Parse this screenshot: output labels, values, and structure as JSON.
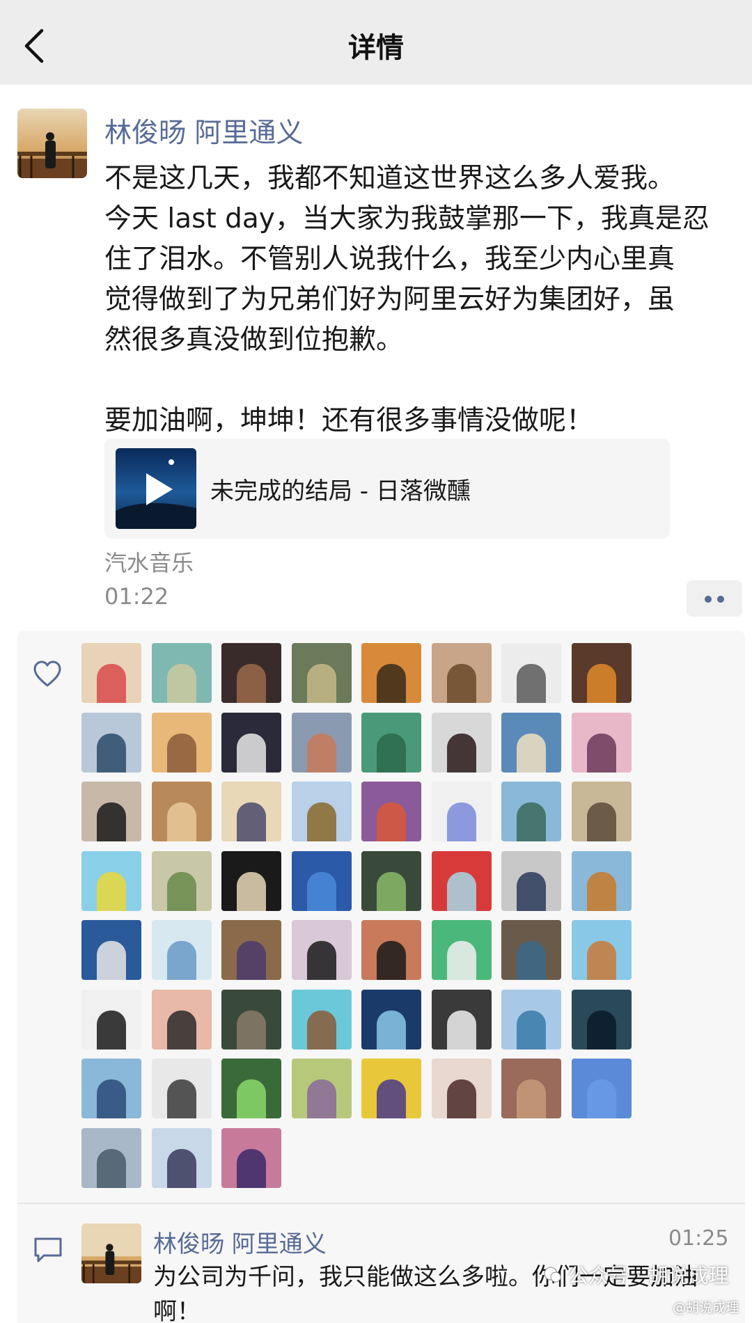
{
  "navbar": {
    "title": "详情",
    "back_icon": "chevron-left-icon"
  },
  "post": {
    "author": "林俊旸 阿里通义",
    "text": "不是这几天，我都不知道这世界这么多人爱我。\n今天 last day，当大家为我鼓掌那一下，我真是忍\n住了泪水。不管别人说我什么，我至少内心里真\n觉得做到了为兄弟们好为阿里云好为集团好，虽\n然很多真没做到位抱歉。\n\n要加油啊，坤坤！还有很多事情没做呢！",
    "music": {
      "title": "未完成的结局 - 日落微醺",
      "play_icon": "play-icon"
    },
    "source": "汽水音乐",
    "time": "01:22",
    "more_icon": "more-dots-icon"
  },
  "likes": {
    "heart_icon": "heart-icon",
    "avatars": [
      {
        "bg": "#e8d3b8",
        "fg": "#d84a4a"
      },
      {
        "bg": "#7fb8b0",
        "fg": "#c9c9a0"
      },
      {
        "bg": "#3a2b2b",
        "fg": "#9a6a4a"
      },
      {
        "bg": "#6a7a5a",
        "fg": "#c4b88a"
      },
      {
        "bg": "#d88a3a",
        "fg": "#3a2a1a"
      },
      {
        "bg": "#c8a488",
        "fg": "#6a4a2a"
      },
      {
        "bg": "#ececec",
        "fg": "#5a5a5a"
      },
      {
        "bg": "#5a3a2a",
        "fg": "#e08a2a"
      },
      {
        "bg": "#b8c8d8",
        "fg": "#2a4a6a"
      },
      {
        "bg": "#e8b878",
        "fg": "#8a5a3a"
      },
      {
        "bg": "#2a2a3a",
        "fg": "#e8e8e8"
      },
      {
        "bg": "#8a9ab0",
        "fg": "#c87a5a"
      },
      {
        "bg": "#4a9a7a",
        "fg": "#2a6a4a"
      },
      {
        "bg": "#d8d8d8",
        "fg": "#2a1a1a"
      },
      {
        "bg": "#5a8ab8",
        "fg": "#f0e0c0"
      },
      {
        "bg": "#e8b8c8",
        "fg": "#6a3a5a"
      },
      {
        "bg": "#c8b8a8",
        "fg": "#1a1a1a"
      },
      {
        "bg": "#b88a5a",
        "fg": "#e8c898"
      },
      {
        "bg": "#e8d8b8",
        "fg": "#4a4a6a"
      },
      {
        "bg": "#b8d0e8",
        "fg": "#8a6a2a"
      },
      {
        "bg": "#8a5a9a",
        "fg": "#d8583a"
      },
      {
        "bg": "#f0f0f0",
        "fg": "#7a8ad8"
      },
      {
        "bg": "#8ab8d8",
        "fg": "#3a6a5a"
      },
      {
        "bg": "#c8b898",
        "fg": "#5a4a3a"
      },
      {
        "bg": "#8ad0e8",
        "fg": "#e8d83a"
      },
      {
        "bg": "#c8c8a8",
        "fg": "#6a8a4a"
      },
      {
        "bg": "#1a1a1a",
        "fg": "#e8d8b8"
      },
      {
        "bg": "#2a5aa8",
        "fg": "#4a8ad8"
      },
      {
        "bg": "#3a4a3a",
        "fg": "#8ab86a"
      },
      {
        "bg": "#d83a3a",
        "fg": "#a8d8e8"
      },
      {
        "bg": "#c8c8c8",
        "fg": "#2a3a5a"
      },
      {
        "bg": "#8ab8d8",
        "fg": "#c87a2a"
      },
      {
        "bg": "#2a5a9a",
        "fg": "#e8e8e8"
      },
      {
        "bg": "#d8e8f0",
        "fg": "#6a9ac8"
      },
      {
        "bg": "#8a6a4a",
        "fg": "#4a3a6a"
      },
      {
        "bg": "#d8c8d8",
        "fg": "#1a1a1a"
      },
      {
        "bg": "#c87a5a",
        "fg": "#1a1a1a"
      },
      {
        "bg": "#4ab87a",
        "fg": "#f0f0f0"
      },
      {
        "bg": "#6a5a4a",
        "fg": "#3a6a8a"
      },
      {
        "bg": "#8ac8e8",
        "fg": "#c87a3a"
      },
      {
        "bg": "#f0f0f0",
        "fg": "#1a1a1a"
      },
      {
        "bg": "#e8b8a8",
        "fg": "#2a2a2a"
      },
      {
        "bg": "#3a4a3a",
        "fg": "#8a7a6a"
      },
      {
        "bg": "#6ac8d8",
        "fg": "#8a5a3a"
      },
      {
        "bg": "#1a3a6a",
        "fg": "#8ac8e8"
      },
      {
        "bg": "#3a3a3a",
        "fg": "#f0f0f0"
      },
      {
        "bg": "#a8c8e8",
        "fg": "#3a7aa8"
      },
      {
        "bg": "#2a4a5a",
        "fg": "#0a1a2a"
      },
      {
        "bg": "#8ab8d8",
        "fg": "#2a4a7a"
      },
      {
        "bg": "#e8e8e8",
        "fg": "#3a3a3a"
      },
      {
        "bg": "#3a6a3a",
        "fg": "#8ad86a"
      },
      {
        "bg": "#b8c87a",
        "fg": "#8a6a9a"
      },
      {
        "bg": "#e8c83a",
        "fg": "#4a3a8a"
      },
      {
        "bg": "#e8d8d0",
        "fg": "#4a2a2a"
      },
      {
        "bg": "#9a6a5a",
        "fg": "#c89a7a"
      },
      {
        "bg": "#5a8ad8",
        "fg": "#6a9ae8"
      },
      {
        "bg": "#a8b8c8",
        "fg": "#4a5a6a"
      },
      {
        "bg": "#c8d8e8",
        "fg": "#3a3a5a"
      },
      {
        "bg": "#c87a9a",
        "fg": "#3a2a6a"
      }
    ]
  },
  "comment": {
    "icon": "comment-bubble-icon",
    "author": "林俊旸 阿里通义",
    "time": "01:25",
    "text": "为公司为千问，我只能做这么多啦。你们一定要加油啊！"
  },
  "watermark": {
    "main": "公众号 · 胡说成理",
    "sub": "@胡说成理"
  }
}
